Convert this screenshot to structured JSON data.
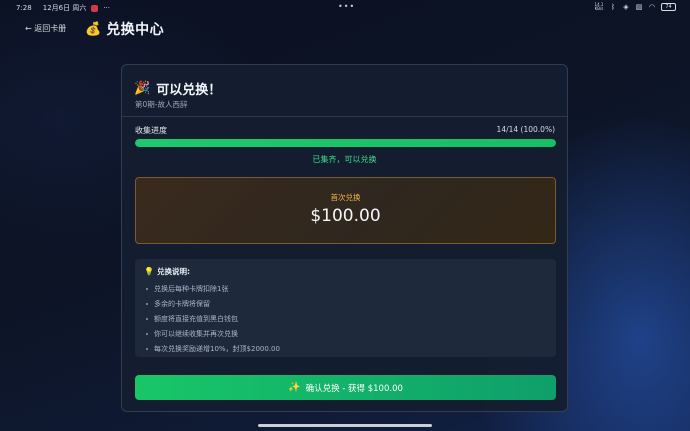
{
  "status_bar": {
    "time": "7:28",
    "date": "12月6日 周六",
    "overflow": "···",
    "center_dots": "•••",
    "network_speed": "14.1\nKB/s",
    "battery": "74"
  },
  "header": {
    "back_label": "← 返回卡册",
    "title": "兑换中心"
  },
  "card": {
    "title": "可以兑换！",
    "subtitle": "第0期-故人西辞",
    "progress_label": "收集进度",
    "progress_count": "14/14 (100.0%)",
    "progress_fraction": 1.0,
    "progress_status": "已集齐，可以兑换",
    "reward_label": "首次兑换",
    "reward_amount": "$100.00",
    "info_title": "兑换说明:",
    "info_items": [
      "兑换后每种卡牌扣除1张",
      "多余的卡牌将保留",
      "额度将直接充值到黑白钱包",
      "你可以继续收集并再次兑换",
      "每次兑换奖励递增10%，封顶$2000.00"
    ],
    "confirm_label": "确认兑换 - 获得 $100.00"
  },
  "colors": {
    "accent_green": "#1ec86c",
    "reward_gold": "#f0b84a"
  }
}
